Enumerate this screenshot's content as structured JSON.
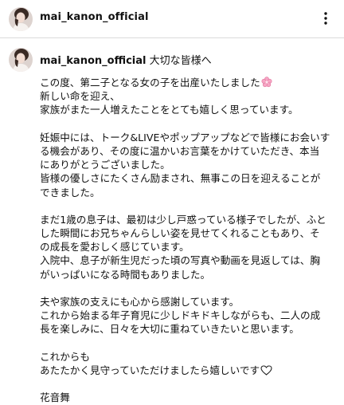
{
  "header": {
    "username": "mai_kanon_official",
    "more_icon": "more-vertical-icon"
  },
  "caption": {
    "username": "mai_kanon_official",
    "title": "大切な皆様へ",
    "paragraphs": [
      [
        "この度、第二子となる女の子を出産いたしました",
        "新しい命を迎え、",
        "家族がまた一人増えたことをとても嬉しく思っています。"
      ],
      [
        "妊娠中には、トーク&LIVEやポップアップなどで皆様にお会いす",
        "る機会があり、その度に温かいお言葉をかけていただき、本当",
        "にありがとうございました。",
        "皆様の優しさにたくさん励まされ、無事この日を迎えることが",
        "できました。"
      ],
      [
        "まだ1歳の息子は、最初は少し戸惑っている様子でしたが、ふと",
        "した瞬間にお兄ちゃんらしい姿を見せてくれることもあり、そ",
        "の成長を愛おしく感じています。",
        "入院中、息子が新生児だった頃の写真や動画を見返しては、胸",
        "がいっぱいになる時間もありました。"
      ],
      [
        "夫や家族の支えにも心から感謝しています。",
        "これから始まる年子育児に少しドキドキしながらも、二人の成",
        "長を楽しみに、日々を大切に重ねていきたいと思います。"
      ],
      [
        "これからも",
        "あたたかく見守っていただけましたら嬉しいです"
      ],
      [
        "花音舞"
      ]
    ],
    "emoji": {
      "flower": "cherry-blossom-icon",
      "heart": "white-heart-icon"
    }
  }
}
